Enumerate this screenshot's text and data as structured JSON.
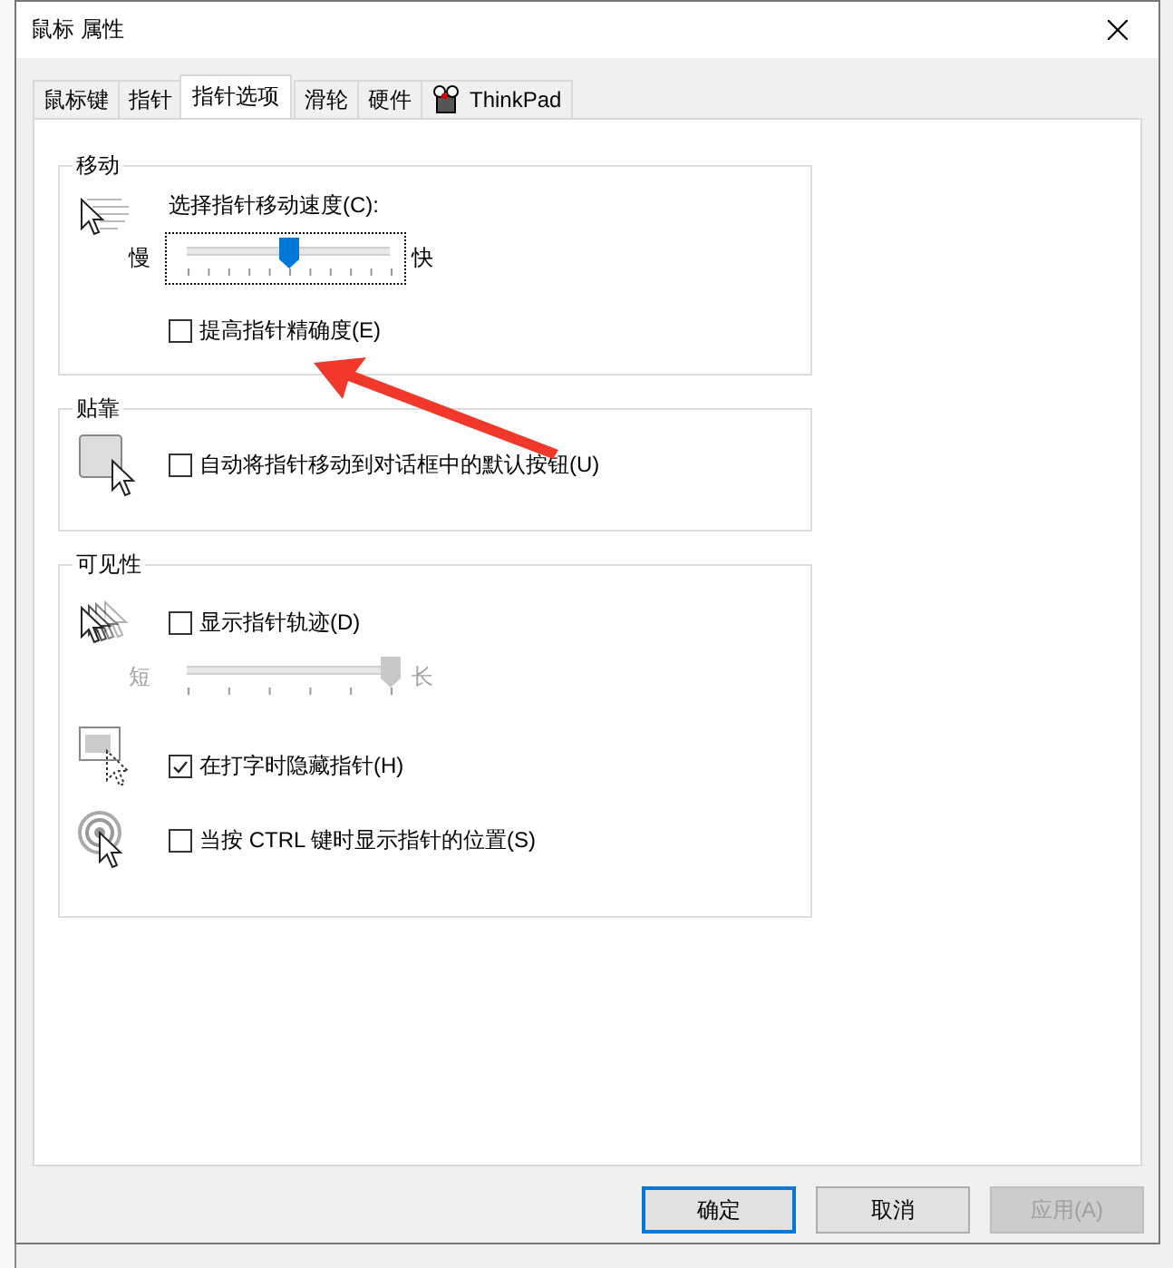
{
  "window": {
    "title": "鼠标 属性"
  },
  "tabs": [
    {
      "label": "鼠标键",
      "selected": false,
      "kind": "text"
    },
    {
      "label": "指针",
      "selected": false,
      "kind": "text"
    },
    {
      "label": "指针选项",
      "selected": true,
      "kind": "text"
    },
    {
      "label": "滑轮",
      "selected": false,
      "kind": "text"
    },
    {
      "label": "硬件",
      "selected": false,
      "kind": "text"
    },
    {
      "label": "ThinkPad",
      "selected": false,
      "kind": "icon"
    }
  ],
  "groups": [
    {
      "title": "移动",
      "items": [
        {
          "kind": "slider",
          "label": "选择指针移动速度(C):",
          "min_label": "慢",
          "max_label": "快",
          "level": 0.5,
          "disabled": false,
          "focused": true
        },
        {
          "kind": "checkbox",
          "label": "提高指针精确度(E)",
          "checked": false
        }
      ]
    },
    {
      "title": "贴靠",
      "items": [
        {
          "kind": "checkbox",
          "label": "自动将指针移动到对话框中的默认按钮(U)",
          "checked": false
        }
      ]
    },
    {
      "title": "可见性",
      "items": [
        {
          "kind": "checkbox",
          "label": "显示指针轨迹(D)",
          "checked": false
        },
        {
          "kind": "slider",
          "min_label": "短",
          "max_label": "长",
          "level": 1,
          "disabled": true,
          "focused": false
        },
        {
          "kind": "checkbox",
          "label": "在打字时隐藏指针(H)",
          "checked": true
        },
        {
          "kind": "checkbox",
          "label": "当按 CTRL 键时显示指针的位置(S)",
          "checked": false
        }
      ]
    }
  ],
  "buttons": [
    {
      "label": "确定",
      "default": true,
      "disabled": false
    },
    {
      "label": "取消",
      "default": false,
      "disabled": false
    },
    {
      "label": "应用(A)",
      "default": false,
      "disabled": true
    }
  ]
}
